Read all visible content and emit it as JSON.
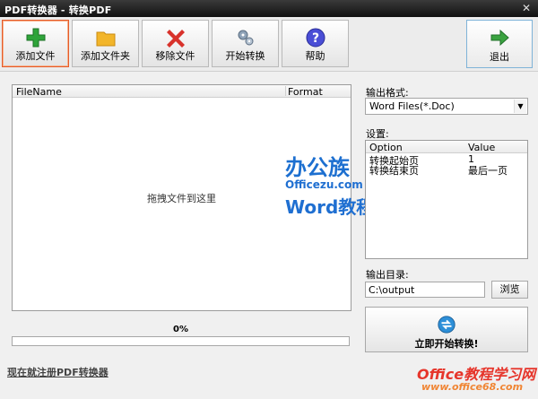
{
  "window": {
    "title": "PDF转换器 - 转换PDF",
    "close": "✕"
  },
  "toolbar": {
    "add_file": "添加文件",
    "add_folder": "添加文件夹",
    "remove_file": "移除文件",
    "start_convert": "开始转换",
    "help": "帮助",
    "exit": "退出"
  },
  "file_list": {
    "columns": [
      "FileName",
      "Format"
    ],
    "placeholder": "拖拽文件到这里"
  },
  "progress": {
    "label": "0%",
    "value": 0
  },
  "register_link": "现在就注册PDF转换器",
  "output_format": {
    "label": "输出格式:",
    "selected": "Word Files(*.Doc)"
  },
  "settings": {
    "label": "设置:",
    "columns": [
      "Option",
      "Value"
    ],
    "rows": [
      {
        "option": "转换起始页",
        "value": "1"
      },
      {
        "option": "转换结束页",
        "value": "最后一页"
      }
    ]
  },
  "output_dir": {
    "label": "输出目录:",
    "value": "C:\\output",
    "browse": "浏览"
  },
  "start_button": "立即开始转换!",
  "watermark": {
    "brand": "办公族",
    "site": "Officezu.com",
    "tag": "Word教程",
    "brand2": "Office教程学习网",
    "site2": "www.office68.com"
  },
  "colors": {
    "accent": "#e55b2a",
    "progress": "#3c9be0",
    "watermark_blue": "#1c6fd0",
    "watermark_red": "#e6352b"
  }
}
